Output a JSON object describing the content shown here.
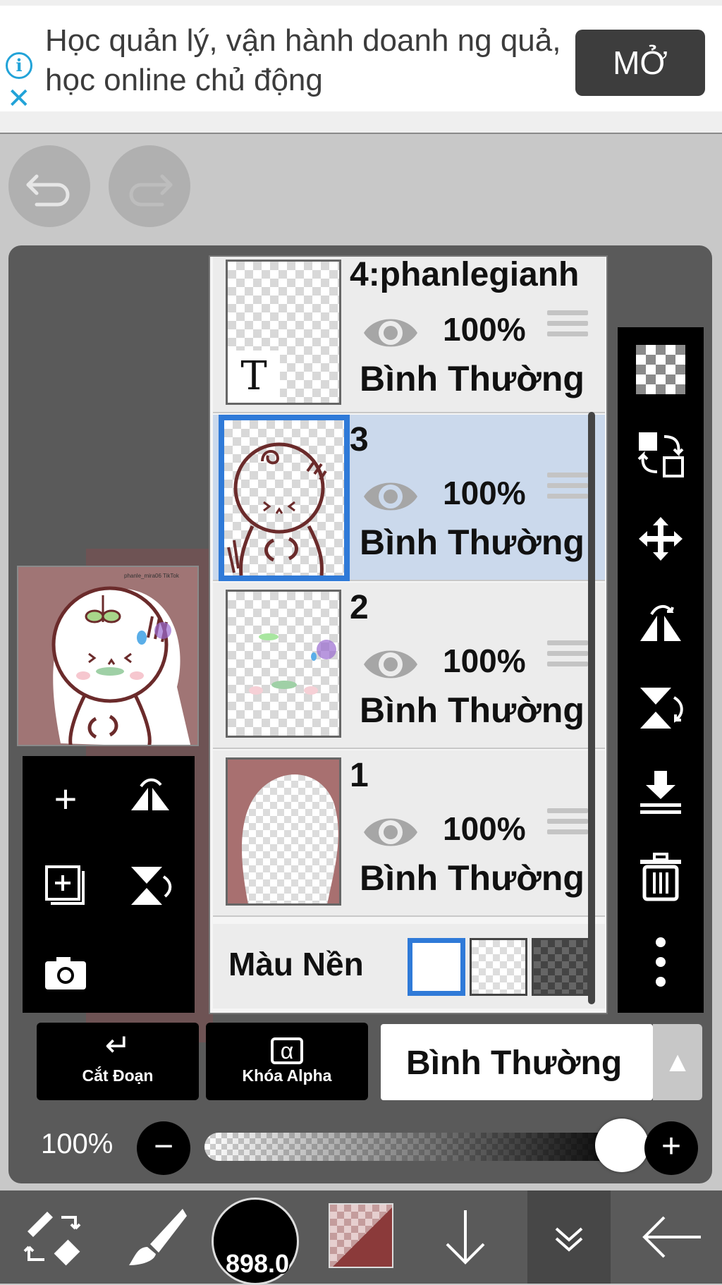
{
  "ad": {
    "text": "Học quản lý, vận hành doanh ng quả, học online chủ động",
    "button": "MỞ",
    "info_icon": "info-icon",
    "close_icon": "close-icon"
  },
  "history": {
    "undo_icon": "undo-icon",
    "redo_icon": "redo-icon"
  },
  "preview": {
    "signature": "phanle_mira06 TikTok"
  },
  "layers": [
    {
      "name": "4:phanlegianh",
      "opacity": "100%",
      "blend": "Bình Thường",
      "visible": true,
      "type": "text",
      "selected": false
    },
    {
      "name": "3",
      "opacity": "100%",
      "blend": "Bình Thường",
      "visible": true,
      "selected": true
    },
    {
      "name": "2",
      "opacity": "100%",
      "blend": "Bình Thường",
      "visible": true,
      "selected": false
    },
    {
      "name": "1",
      "opacity": "100%",
      "blend": "Bình Thường",
      "visible": true,
      "selected": false
    }
  ],
  "background": {
    "label": "Màu Nền",
    "selected": "white"
  },
  "actions": {
    "clipping": "Cắt Đoạn",
    "alpha_lock": "Khóa Alpha",
    "alpha_symbol": "α",
    "blend_mode": "Bình Thường"
  },
  "opacity": {
    "label": "100%",
    "value": 1.0
  },
  "brush": {
    "size_label": "898.0"
  },
  "colors": {
    "accent": "#2f7ad8",
    "primary_color": "#8b3a3a",
    "ad_blue": "#22a3d8"
  }
}
